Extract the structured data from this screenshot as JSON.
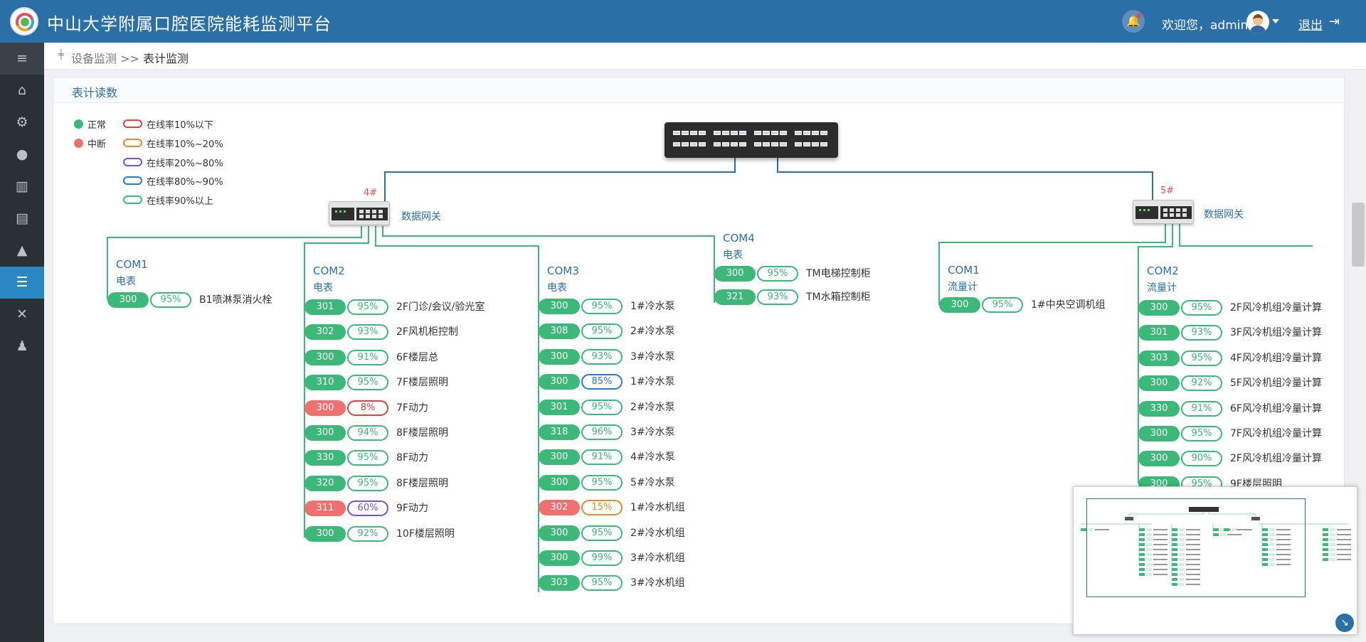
{
  "header": {
    "title": "中山大学附属口腔医院能耗监测平台",
    "welcome": "欢迎您，admin",
    "logout": "退出"
  },
  "breadcrumb": {
    "parent": "设备监测",
    "sep": ">>",
    "current": "表计监测"
  },
  "panel": {
    "title": "表计读数"
  },
  "legend": {
    "status": [
      {
        "label": "正常",
        "color": "#3cb878"
      },
      {
        "label": "中断",
        "color": "#f07070"
      }
    ],
    "rates": [
      {
        "label": "在线率10%以下",
        "color": "#e04040"
      },
      {
        "label": "在线率10%~20%",
        "color": "#e8892a"
      },
      {
        "label": "在线率20%~80%",
        "color": "#7a4fd0"
      },
      {
        "label": "在线率80%~90%",
        "color": "#2a7bd0"
      },
      {
        "label": "在线率90%以上",
        "color": "#3cb878"
      }
    ]
  },
  "gateways": [
    {
      "num": "4#",
      "label": "数据网关"
    },
    {
      "num": "5#",
      "label": "数据网关"
    }
  ],
  "coms": [
    {
      "name": "COM1",
      "type": "电表",
      "items": [
        {
          "reading": "300",
          "rate": "95%",
          "name": "B1喷淋泵消火栓",
          "status": "normal",
          "level": 5
        }
      ]
    },
    {
      "name": "COM2",
      "type": "电表",
      "items": [
        {
          "reading": "301",
          "rate": "95%",
          "name": "2F门诊/会议/验光室",
          "status": "normal",
          "level": 5
        },
        {
          "reading": "302",
          "rate": "93%",
          "name": "2F风机柜控制",
          "status": "normal",
          "level": 5
        },
        {
          "reading": "300",
          "rate": "91%",
          "name": "6F楼层总",
          "status": "normal",
          "level": 5
        },
        {
          "reading": "310",
          "rate": "95%",
          "name": "7F楼层照明",
          "status": "normal",
          "level": 5
        },
        {
          "reading": "300",
          "rate": "8%",
          "name": "7F动力",
          "status": "broken",
          "level": 1
        },
        {
          "reading": "300",
          "rate": "94%",
          "name": "8F楼层照明",
          "status": "normal",
          "level": 5
        },
        {
          "reading": "330",
          "rate": "95%",
          "name": "8F动力",
          "status": "normal",
          "level": 5
        },
        {
          "reading": "320",
          "rate": "95%",
          "name": "8F楼层照明",
          "status": "normal",
          "level": 5
        },
        {
          "reading": "311",
          "rate": "60%",
          "name": "9F动力",
          "status": "broken",
          "level": 3
        },
        {
          "reading": "300",
          "rate": "92%",
          "name": "10F楼层照明",
          "status": "normal",
          "level": 5
        }
      ]
    },
    {
      "name": "COM3",
      "type": "电表",
      "items": [
        {
          "reading": "300",
          "rate": "95%",
          "name": "1#冷水泵",
          "status": "normal",
          "level": 5
        },
        {
          "reading": "308",
          "rate": "95%",
          "name": "2#冷水泵",
          "status": "normal",
          "level": 5
        },
        {
          "reading": "300",
          "rate": "93%",
          "name": "3#冷水泵",
          "status": "normal",
          "level": 5
        },
        {
          "reading": "300",
          "rate": "85%",
          "name": "1#冷水泵",
          "status": "normal",
          "level": 4
        },
        {
          "reading": "301",
          "rate": "95%",
          "name": "2#冷水泵",
          "status": "normal",
          "level": 5
        },
        {
          "reading": "318",
          "rate": "96%",
          "name": "3#冷水泵",
          "status": "normal",
          "level": 5
        },
        {
          "reading": "300",
          "rate": "91%",
          "name": "4#冷水泵",
          "status": "normal",
          "level": 5
        },
        {
          "reading": "300",
          "rate": "95%",
          "name": "5#冷水泵",
          "status": "normal",
          "level": 5
        },
        {
          "reading": "302",
          "rate": "15%",
          "name": "1#冷水机组",
          "status": "broken",
          "level": 2
        },
        {
          "reading": "300",
          "rate": "95%",
          "name": "2#冷水机组",
          "status": "normal",
          "level": 5
        },
        {
          "reading": "300",
          "rate": "99%",
          "name": "3#冷水机组",
          "status": "normal",
          "level": 5
        },
        {
          "reading": "303",
          "rate": "95%",
          "name": "3#冷水机组",
          "status": "normal",
          "level": 5
        }
      ]
    },
    {
      "name": "COM4",
      "type": "电表",
      "items": [
        {
          "reading": "300",
          "rate": "95%",
          "name": "TM电梯控制柜",
          "status": "normal",
          "level": 5
        },
        {
          "reading": "321",
          "rate": "93%",
          "name": "TM水箱控制柜",
          "status": "normal",
          "level": 5
        }
      ]
    },
    {
      "name": "COM1",
      "type": "流量计",
      "items": [
        {
          "reading": "300",
          "rate": "95%",
          "name": "1#中央空调机组",
          "status": "normal",
          "level": 5
        }
      ]
    },
    {
      "name": "COM2",
      "type": "流量计",
      "items": [
        {
          "reading": "300",
          "rate": "95%",
          "name": "2F风冷机组冷量计算",
          "status": "normal",
          "level": 5
        },
        {
          "reading": "301",
          "rate": "93%",
          "name": "3F风冷机组冷量计算",
          "status": "normal",
          "level": 5
        },
        {
          "reading": "303",
          "rate": "95%",
          "name": "4F风冷机组冷量计算",
          "status": "normal",
          "level": 5
        },
        {
          "reading": "300",
          "rate": "92%",
          "name": "5F风冷机组冷量计算",
          "status": "normal",
          "level": 5
        },
        {
          "reading": "330",
          "rate": "91%",
          "name": "6F风冷机组冷量计算",
          "status": "normal",
          "level": 5
        },
        {
          "reading": "300",
          "rate": "95%",
          "name": "7F风冷机组冷量计算",
          "status": "normal",
          "level": 5
        },
        {
          "reading": "300",
          "rate": "90%",
          "name": "2F风冷机组冷量计算",
          "status": "normal",
          "level": 5
        },
        {
          "reading": "300",
          "rate": "95%",
          "name": "9F楼层照明",
          "status": "normal",
          "level": 5
        }
      ]
    }
  ],
  "sidebar": {
    "icons": [
      "menu-icon",
      "home-icon",
      "gear-icon",
      "money-bag-icon",
      "bar-chart-icon",
      "document-icon",
      "warning-icon",
      "sliders-icon",
      "wrench-icon",
      "user-icon"
    ]
  }
}
